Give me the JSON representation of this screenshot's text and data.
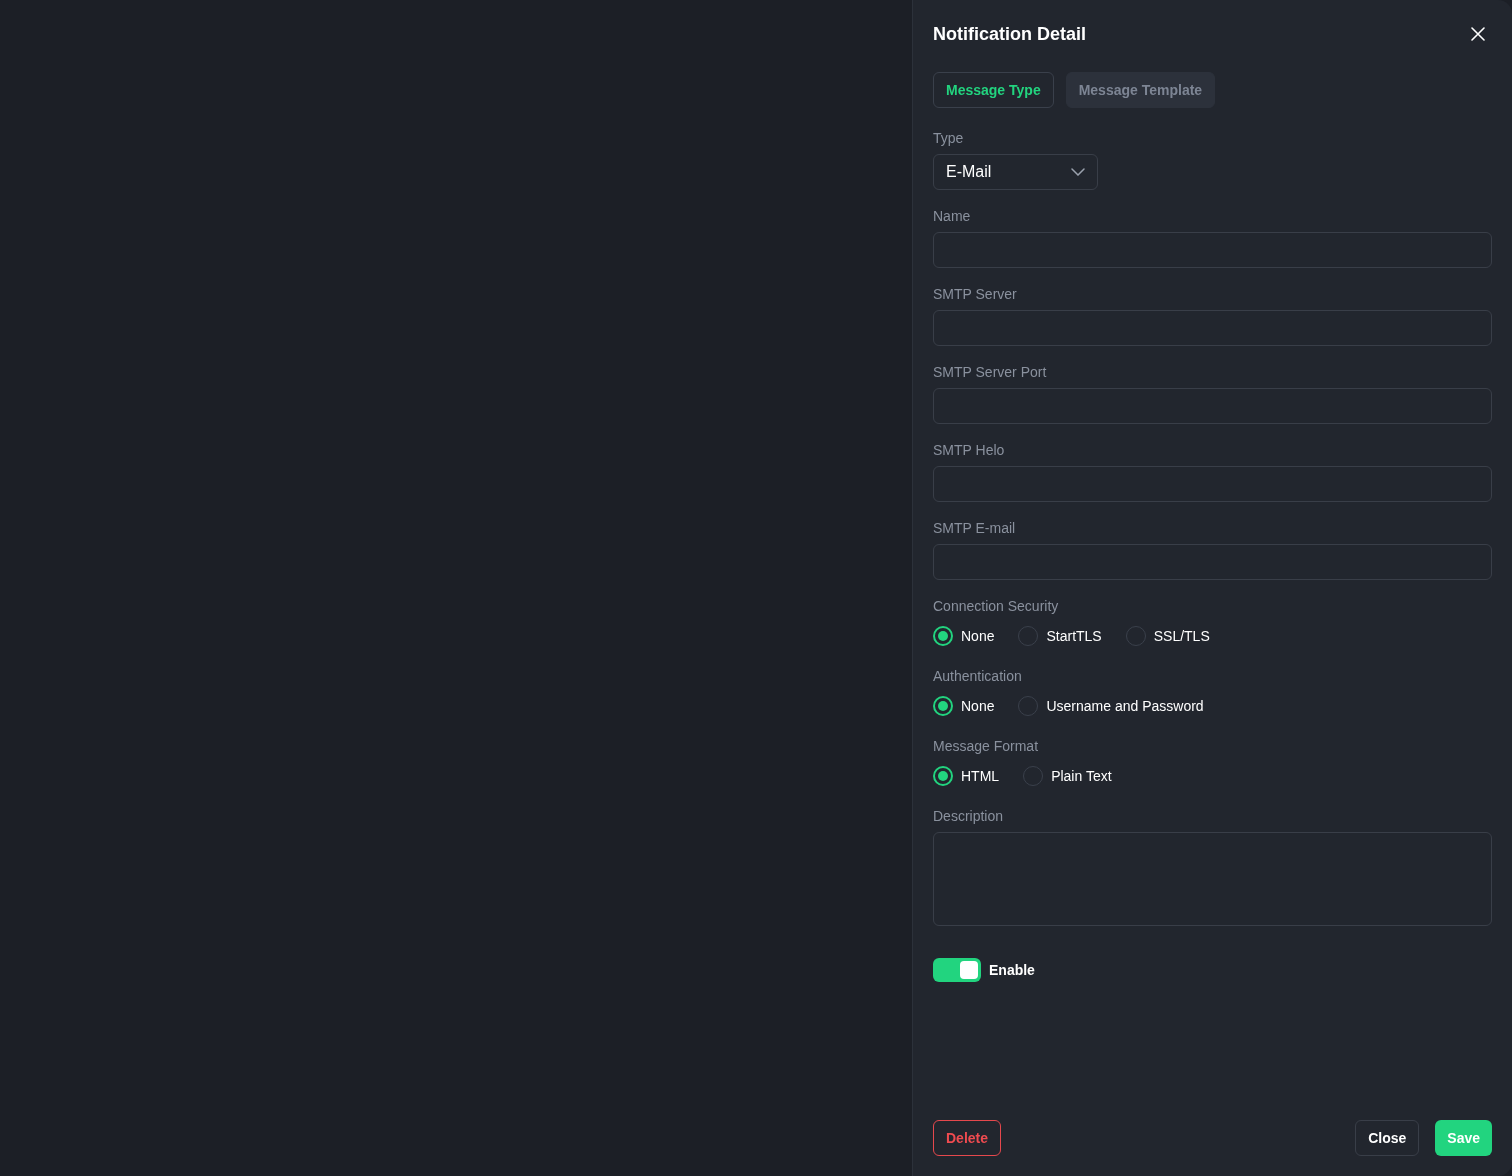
{
  "panel": {
    "title": "Notification Detail"
  },
  "tabs": [
    {
      "label": "Message Type",
      "selected": true
    },
    {
      "label": "Message Template",
      "selected": false
    }
  ],
  "fields": [
    {
      "kind": "select",
      "label": "Type",
      "value": "E-Mail"
    },
    {
      "kind": "text",
      "label": "Name"
    },
    {
      "kind": "text",
      "label": "SMTP Server"
    },
    {
      "kind": "text",
      "label": "SMTP Server Port"
    },
    {
      "kind": "text",
      "label": "SMTP Helo"
    },
    {
      "kind": "text",
      "label": "SMTP E-mail"
    },
    {
      "kind": "radio",
      "label": "Connection Security",
      "options": [
        {
          "label": "None",
          "selected": true
        },
        {
          "label": "StartTLS",
          "selected": false
        },
        {
          "label": "SSL/TLS",
          "selected": false
        }
      ]
    },
    {
      "kind": "radio",
      "label": "Authentication",
      "options": [
        {
          "label": "None",
          "selected": true
        },
        {
          "label": "Username and Password",
          "selected": false
        }
      ]
    },
    {
      "kind": "radio",
      "label": "Message Format",
      "options": [
        {
          "label": "HTML",
          "selected": true
        },
        {
          "label": "Plain Text",
          "selected": false
        }
      ]
    },
    {
      "kind": "textarea",
      "label": "Description"
    }
  ],
  "enable": {
    "label": "Enable",
    "on": true
  },
  "buttons": [
    {
      "kind": "danger",
      "label": "Delete"
    },
    {
      "kind": "secondary",
      "label": "Close"
    },
    {
      "kind": "primary",
      "label": "Save"
    }
  ]
}
